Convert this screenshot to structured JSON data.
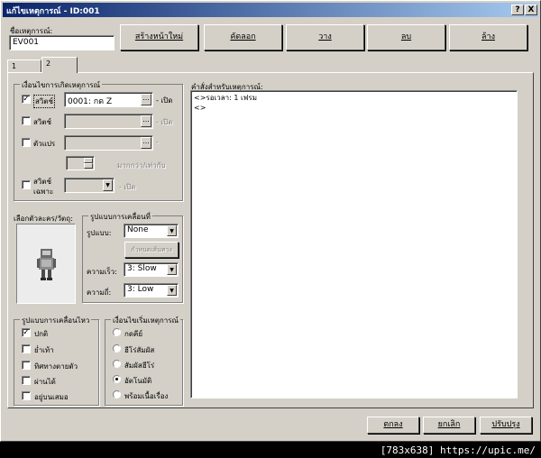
{
  "window": {
    "title": "แก้ไขเหตุการณ์ - ID:001",
    "help_btn": "?",
    "close_btn": "X"
  },
  "event_name": {
    "label": "ชื่อเหตุการณ์:",
    "value": "EV001"
  },
  "toolbar": {
    "new_page": "สร้างหน้าใหม่",
    "copy": "คัดลอก",
    "paste": "วาง",
    "delete": "ลบ",
    "clear": "ล้าง"
  },
  "tabs": [
    "1",
    "2"
  ],
  "conditions": {
    "title": "เงื่อนไขการเกิดเหตุการณ์",
    "switch1": {
      "label": "สวิตช์",
      "value": "0001: กด Z",
      "suffix": "- เปิด",
      "checked": "✓"
    },
    "switch2": {
      "label": "สวิตช์",
      "suffix": "- เปิด"
    },
    "variable": {
      "label": "ตัวแปร",
      "suffix": "-"
    },
    "compare": "มากกว่า/เท่ากับ",
    "self_switch": {
      "label1": "สวิตช์",
      "label2": "เฉพาะ",
      "suffix": "- เปิด"
    }
  },
  "graphic": {
    "label": "เลือกตัวละคร/วัตถุ:"
  },
  "movement": {
    "title": "รูปแบบการเคลื่อนที่",
    "type_label": "รูปแบบ:",
    "type_value": "None",
    "route_btn": "กำหนดเส้นทาง",
    "speed_label": "ความเร็ว:",
    "speed_value": "3: Slow",
    "freq_label": "ความถี่:",
    "freq_value": "3: Low"
  },
  "options": {
    "title": "รูปแบบการเคลื่อนไหว",
    "items": [
      {
        "label": "ปกติ",
        "checked": "✓"
      },
      {
        "label": "ย่ำเท้า",
        "checked": ""
      },
      {
        "label": "ทิศทางตายตัว",
        "checked": ""
      },
      {
        "label": "ผ่านได้",
        "checked": ""
      },
      {
        "label": "อยู่บนเสมอ",
        "checked": ""
      }
    ]
  },
  "trigger": {
    "title": "เงื่อนไขเริ่มเหตุการณ์",
    "items": [
      {
        "label": "กดคีย์",
        "selected": false
      },
      {
        "label": "ฮีโร่สัมผัส",
        "selected": false
      },
      {
        "label": "สัมผัสฮีโร่",
        "selected": false
      },
      {
        "label": "อัตโนมัติ",
        "selected": true
      },
      {
        "label": "พร้อมเนื้อเรื่อง",
        "selected": false
      }
    ]
  },
  "commands": {
    "label": "คำสั่งสำหรับเหตุการณ์:",
    "lines": [
      "<>รอเวลา: 1 เฟรม",
      "<>"
    ]
  },
  "footer_buttons": {
    "ok": "ตกลง",
    "cancel": "ยกเลิก",
    "apply": "ปรับปรุง"
  },
  "watermark": "[783x638] https://upic.me/"
}
